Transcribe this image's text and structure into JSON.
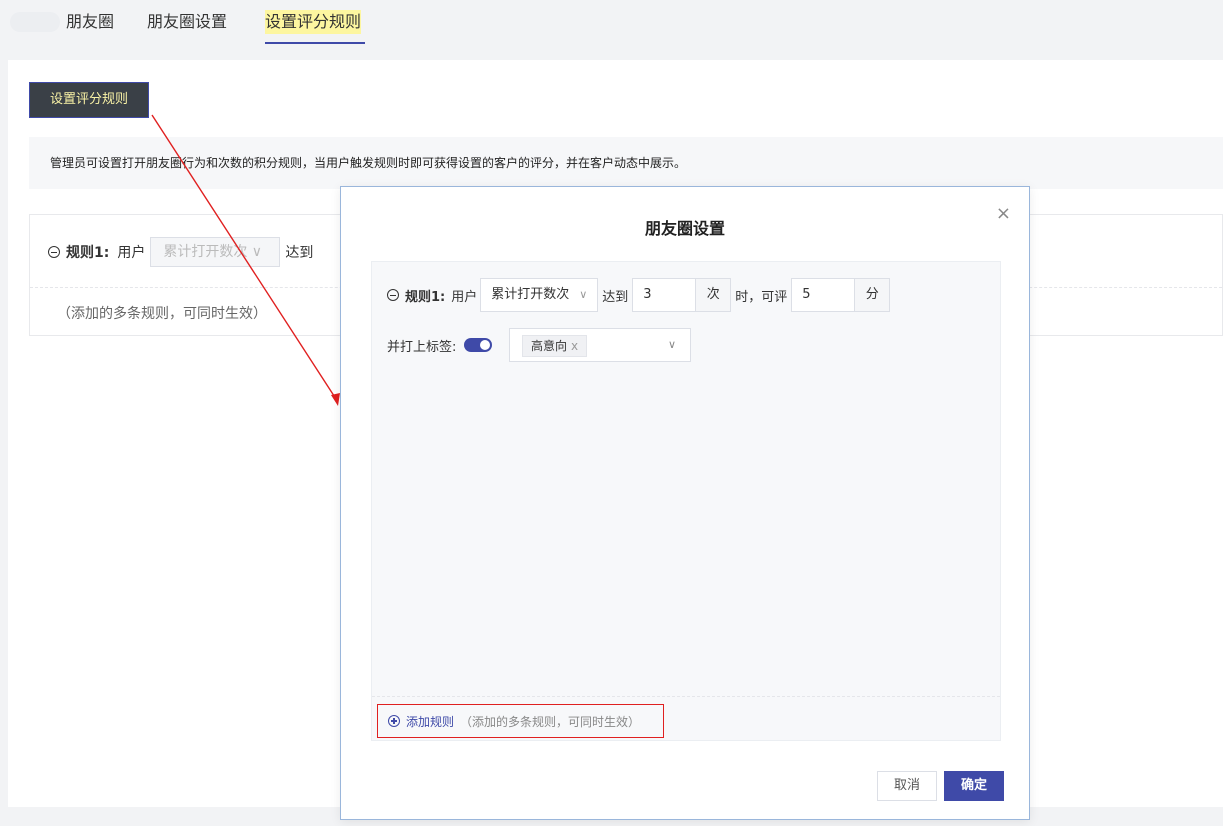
{
  "nav": {
    "tabs": [
      {
        "label": "朋友圈"
      },
      {
        "label": "朋友圈设置"
      },
      {
        "label": "设置评分规则"
      }
    ]
  },
  "page": {
    "set_rule_button": "设置评分规则",
    "notice": "管理员可设置打开朋友圈行为和次数的积分规则，当用户触发规则时即可获得设置的客户的评分，并在客户动态中展示。",
    "rule_label": "规则1:",
    "user_label": "用户",
    "action_select": "累计打开数次",
    "reach_label": "达到",
    "multi_hint": "（添加的多条规则，可同时生效）"
  },
  "modal": {
    "title": "朋友圈设置",
    "close_symbol": "×",
    "rule_label": "规则1:",
    "user_label": "用户",
    "action_select": "累计打开数次",
    "reach_label": "达到",
    "count_value": "3",
    "count_unit": "次",
    "then_label": "时，可评",
    "score_value": "5",
    "score_unit": "分",
    "tag_label": "并打上标签:",
    "tag_toggle_on": true,
    "tags": [
      "高意向"
    ],
    "add_rule_label": "添加规则",
    "add_rule_hint": "（添加的多条规则，可同时生效）",
    "cancel_label": "取消",
    "confirm_label": "确定"
  },
  "colors": {
    "accent": "#3f4aa8",
    "highlight": "#fdf6a0",
    "annotation_red": "#e02020"
  }
}
